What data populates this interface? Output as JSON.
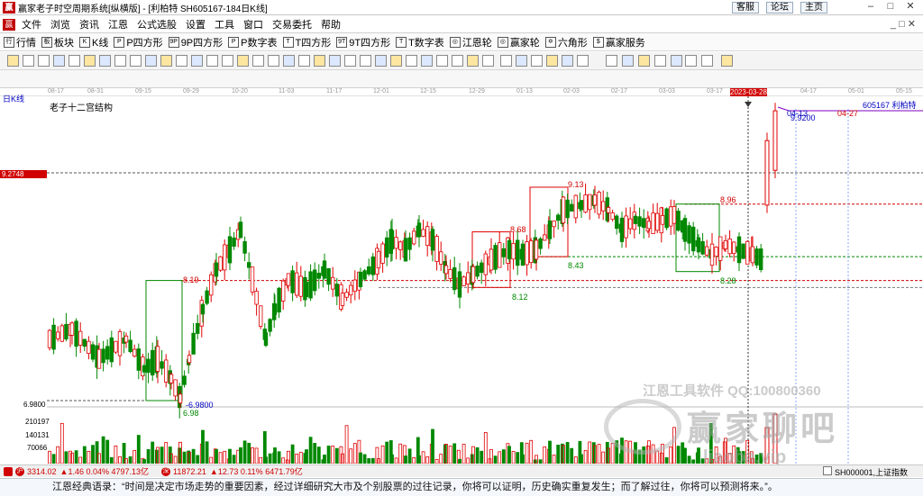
{
  "window": {
    "title": "赢家老子时空周期系统[纵横版] - [利柏特  SH605167-184日K线]",
    "links": [
      "客服",
      "论坛",
      "主页"
    ]
  },
  "menu": [
    "文件",
    "浏览",
    "资讯",
    "江恩",
    "公式选股",
    "设置",
    "工具",
    "窗口",
    "交易委托",
    "帮助"
  ],
  "toolbar": [
    {
      "icon": "行",
      "label": "行情"
    },
    {
      "icon": "板",
      "label": "板块"
    },
    {
      "icon": "K",
      "label": "K线"
    },
    {
      "icon": "P",
      "label": "P四方形"
    },
    {
      "icon": "9P",
      "label": "9P四方形"
    },
    {
      "icon": "P",
      "label": "P数字表"
    },
    {
      "icon": "T",
      "label": "T四方形"
    },
    {
      "icon": "9T",
      "label": "9T四方形"
    },
    {
      "icon": "T",
      "label": "T数字表"
    },
    {
      "icon": "◎",
      "label": "江恩轮"
    },
    {
      "icon": "◎",
      "label": "赢家轮"
    },
    {
      "icon": "✡",
      "label": "六角形"
    },
    {
      "icon": "$",
      "label": "赢家服务"
    }
  ],
  "date_axis": [
    "08-17",
    "08-31",
    "09-15",
    "09-29",
    "10-20",
    "11-03",
    "11-17",
    "12-01",
    "12-15",
    "12-29",
    "01-13",
    "02-03",
    "02-17",
    "03-03",
    "03-17",
    "2023-03-28",
    "04-17",
    "05-01",
    "05-15"
  ],
  "chart": {
    "period_label": "日K线",
    "structure_title": "老子十二宫结构",
    "stock": "605167  利柏特",
    "price_marker": "9.2748",
    "low_marker": "6.9800",
    "future_date_1": "04-13",
    "future_date_2": "04-27",
    "future_price": "9.9200",
    "box_labels": [
      "8.19",
      "6.98",
      "-6.9800",
      "8.68",
      "8.12",
      "9.13",
      "8.43",
      "8.96",
      "8.28"
    ],
    "volume_ticks": [
      "210197",
      "140131",
      "70066"
    ],
    "up_color": "#e00000",
    "down_color": "#008800"
  },
  "chart_data": {
    "type": "candlestick",
    "title": "老子十二宫结构",
    "ylabel": "",
    "ylim": [
      6.9,
      10.1
    ],
    "reference_levels": [
      9.2748,
      8.19,
      8.96,
      8.43,
      8.12,
      6.98
    ],
    "boxes": [
      {
        "low": 6.98,
        "high": 8.19
      },
      {
        "low": 8.12,
        "high": 8.68
      },
      {
        "low": 8.43,
        "high": 9.13
      },
      {
        "low": 8.28,
        "high": 8.96
      }
    ],
    "volume_ticks": [
      210197,
      140131,
      70066
    ]
  },
  "status": {
    "sh": "3314.02",
    "sh_chg": "▲1.46 0.04% 4797.13亿",
    "sz": "11872.21",
    "sz_chg": "▲12.73 0.11% 6471.79亿",
    "index_code": "SH000001,上证指数"
  },
  "quote": "江恩经典语录：“时间是决定市场走势的重要因素，经过详细研究大市及个别股票的过往记录，你将可以证明，历史确实重复发生；而了解过往，你将可以预测将来。”。",
  "watermark": {
    "line1": "江恩工具软件  QQ:100800360",
    "line2": "赢家聊吧",
    "line3": "liaoba.vip"
  }
}
